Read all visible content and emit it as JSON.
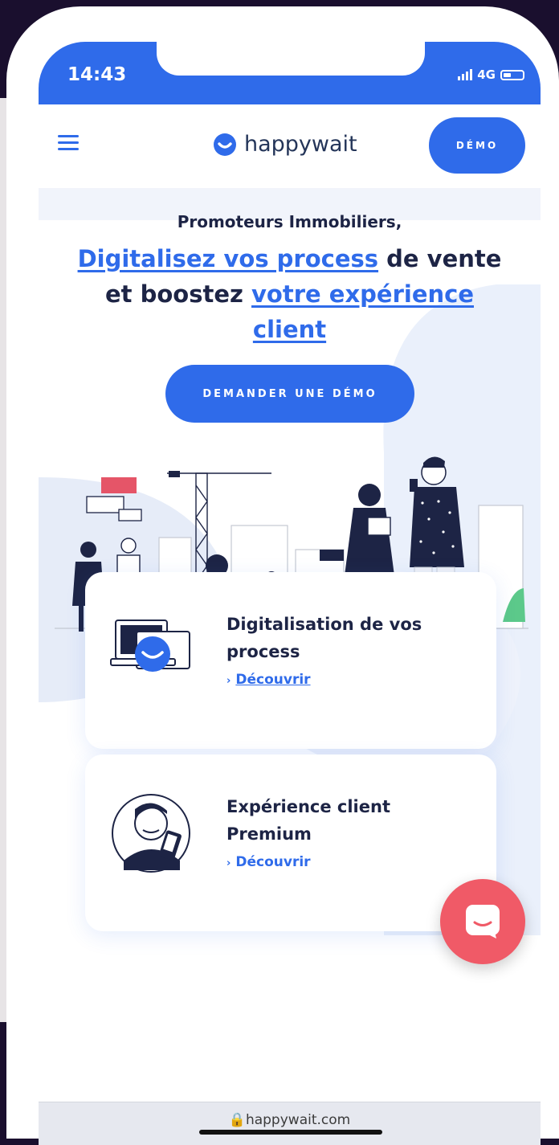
{
  "status_bar": {
    "time": "14:43",
    "network": "4G"
  },
  "nav": {
    "logo_text": "happywait",
    "demo_label": "DÉMO"
  },
  "hero": {
    "kicker": "Promoteurs Immobiliers,",
    "headline_part1": "Digitalisez vos process",
    "headline_part2": " de vente et boostez ",
    "headline_part3": "votre expérience client",
    "cta_label": "DEMANDER UNE DÉMO"
  },
  "features": [
    {
      "title": "Digitalisation de vos process",
      "link": "Découvrir",
      "icon": "devices-icon"
    },
    {
      "title": "Expérience client Premium",
      "link": "Découvrir",
      "icon": "customer-portrait-icon"
    }
  ],
  "chat": {
    "icon": "chat-icon"
  },
  "browser": {
    "url": "happywait.com"
  },
  "colors": {
    "brand_blue": "#2f6bea",
    "chat_red": "#f05a67",
    "text_dark": "#1d2445"
  }
}
